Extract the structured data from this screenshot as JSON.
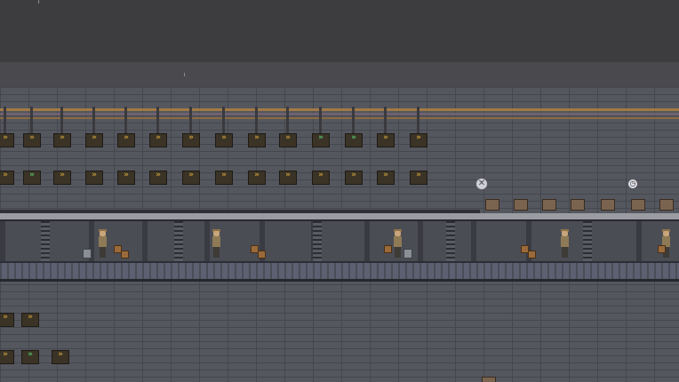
{
  "scene": {
    "title": "",
    "icons": {
      "close": "✕",
      "clock": "◷",
      "chevron": "»"
    },
    "colors": {
      "sky": "#3d3d3f",
      "wall": "#55575f",
      "pipe_copper": "#a07a45",
      "chevron_gold": "#c89a3c",
      "chevron_green": "#55c06a"
    }
  }
}
